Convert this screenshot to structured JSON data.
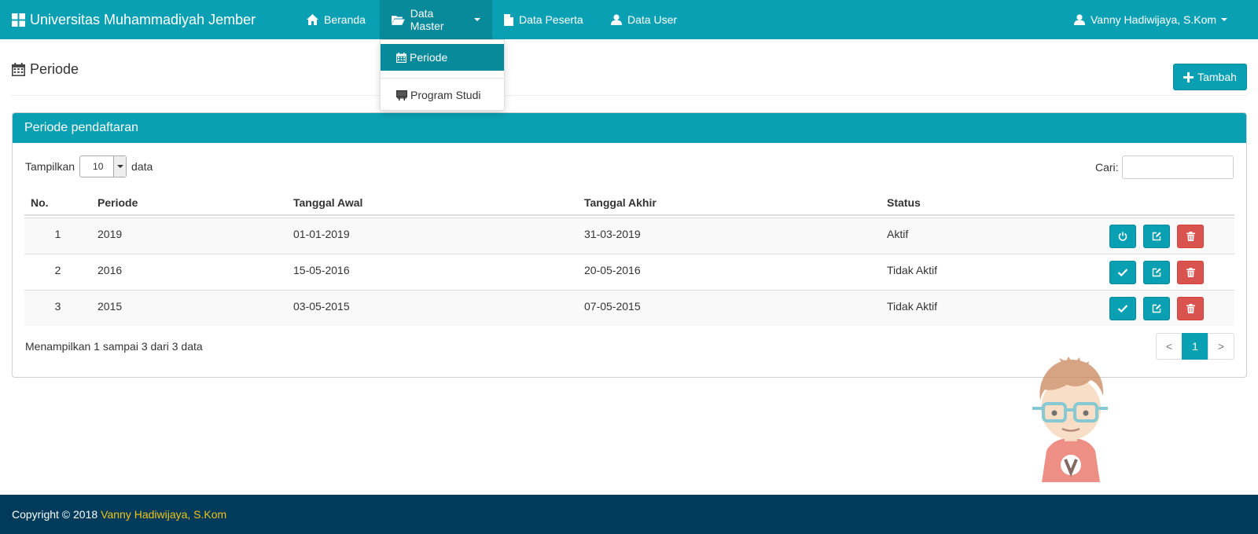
{
  "navbar": {
    "brand": "Universitas Muhammadiyah Jember",
    "items": [
      {
        "label": "Beranda",
        "icon": "home-icon"
      },
      {
        "label": "Data Master",
        "icon": "folder-open-icon"
      },
      {
        "label": "Data Peserta",
        "icon": "file-icon"
      },
      {
        "label": "Data User",
        "icon": "user-icon"
      }
    ],
    "user": "Vanny Hadiwijaya, S.Kom"
  },
  "dropdown": {
    "items": [
      {
        "label": "Periode",
        "icon": "calendar-icon"
      },
      {
        "label": "Program Studi",
        "icon": "blackboard-icon"
      }
    ]
  },
  "page": {
    "title": "Periode",
    "add_button": "Tambah"
  },
  "panel": {
    "title": "Periode pendaftaran",
    "length_prefix": "Tampilkan",
    "length_value": "10",
    "length_suffix": "data",
    "search_label": "Cari:",
    "search_value": ""
  },
  "table": {
    "columns": [
      "No.",
      "Periode",
      "Tanggal Awal",
      "Tanggal Akhir",
      "Status"
    ],
    "rows": [
      {
        "no": "1",
        "periode": "2019",
        "awal": "01-01-2019",
        "akhir": "31-03-2019",
        "status": "Aktif",
        "toggle_icon": "power-icon"
      },
      {
        "no": "2",
        "periode": "2016",
        "awal": "15-05-2016",
        "akhir": "20-05-2016",
        "status": "Tidak Aktif",
        "toggle_icon": "check-icon"
      },
      {
        "no": "3",
        "periode": "2015",
        "awal": "03-05-2015",
        "akhir": "07-05-2015",
        "status": "Tidak Aktif",
        "toggle_icon": "check-icon"
      }
    ]
  },
  "footer_info": "Menampilkan 1 sampai 3 dari 3 data",
  "pagination": {
    "prev": "<",
    "current": "1",
    "next": ">"
  },
  "footer": {
    "copyright": "Copyright © 2018",
    "author": "Vanny Hadiwijaya, S.Kom"
  },
  "colors": {
    "primary": "#0aa0b3",
    "primary_dark": "#088a9a",
    "danger": "#d9534f",
    "footer_bg": "#003b5c",
    "footer_author": "#f0c419"
  }
}
